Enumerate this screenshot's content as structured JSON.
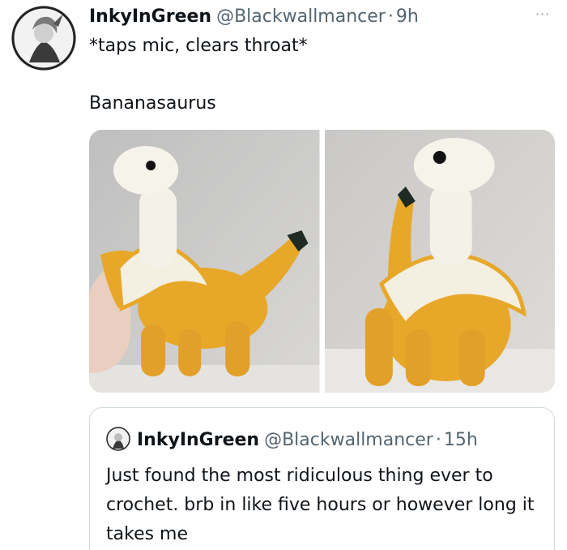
{
  "tweet": {
    "author_name": "InkyInGreen",
    "author_handle": "@Blackwallmancer",
    "separator": "·",
    "time": "9h",
    "more_icon": "···",
    "text_line1": "*taps mic, clears throat*",
    "text_line2": "Bananasaurus",
    "media": [
      {
        "icon": "photo-crochet-banana-dino-side"
      },
      {
        "icon": "photo-crochet-banana-dino-front"
      }
    ]
  },
  "quote": {
    "author_name": "InkyInGreen",
    "author_handle": "@Blackwallmancer",
    "separator": "·",
    "time": "15h",
    "text": "Just found the most ridiculous thing ever to crochet. brb in like five hours or however long it takes me"
  },
  "colors": {
    "text_primary": "#0f1419",
    "text_secondary": "#536471",
    "border": "#cfd9de",
    "banana_yellow": "#e7a82a",
    "peel_cream": "#f3efe1"
  }
}
